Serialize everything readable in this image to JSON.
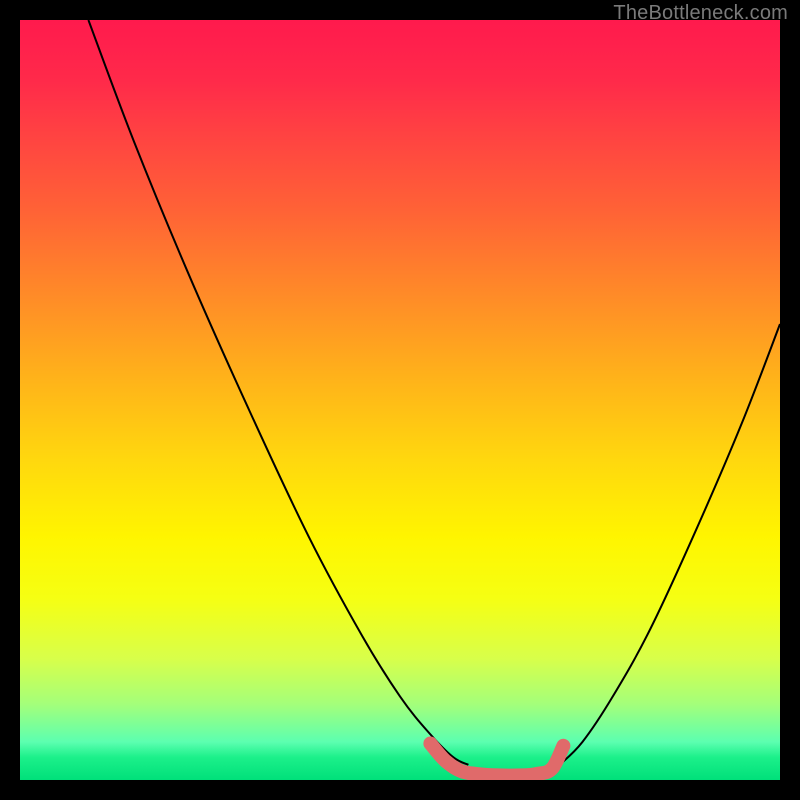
{
  "watermark": "TheBottleneck.com",
  "colors": {
    "frame": "#000000",
    "curve": "#000000",
    "marker": "#e06a6a",
    "gradient_top": "#ff1a4d",
    "gradient_bottom": "#00e07a"
  },
  "chart_data": {
    "type": "line",
    "title": "",
    "xlabel": "",
    "ylabel": "",
    "xlim": [
      0,
      100
    ],
    "ylim": [
      0,
      100
    ],
    "series": [
      {
        "name": "left_curve",
        "x": [
          9,
          15,
          22,
          30,
          38,
          45,
          50,
          54,
          57,
          59
        ],
        "y": [
          100,
          84,
          67,
          49,
          32,
          19,
          11,
          6,
          3,
          2
        ]
      },
      {
        "name": "right_curve",
        "x": [
          71,
          74,
          78,
          83,
          89,
          95,
          100
        ],
        "y": [
          2,
          5,
          11,
          20,
          33,
          47,
          60
        ]
      },
      {
        "name": "optimal_marker",
        "x": [
          54,
          56,
          58,
          60,
          63,
          66,
          68,
          70,
          71.5
        ],
        "y": [
          4.8,
          2.5,
          1.2,
          0.8,
          0.6,
          0.6,
          0.8,
          1.5,
          4.5
        ]
      }
    ],
    "annotations": []
  }
}
